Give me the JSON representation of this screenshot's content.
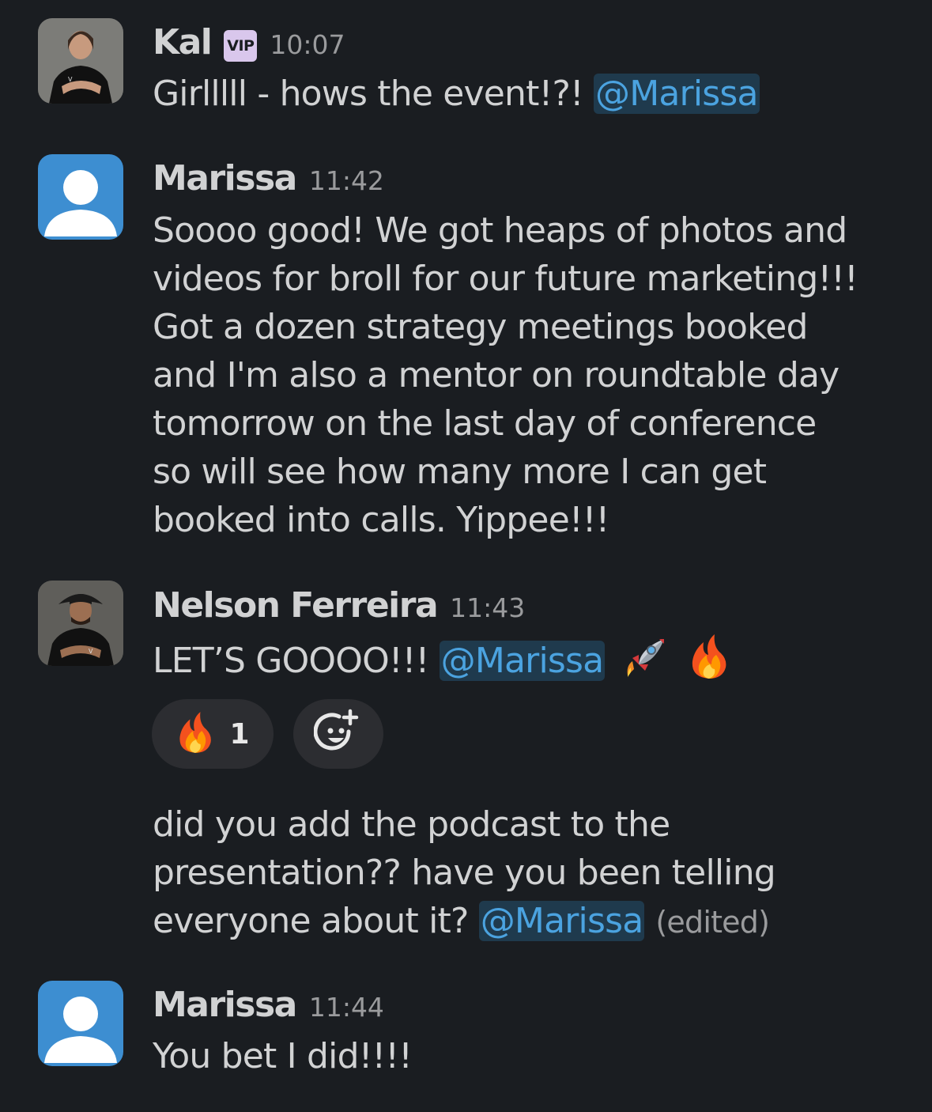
{
  "messages": [
    {
      "author": "Kal",
      "badge": "VIP",
      "time": "10:07",
      "avatar": "kal-avatar",
      "text": "Girlllll - hows the event!?! ",
      "mention": "@Marissa"
    },
    {
      "author": "Marissa",
      "time": "11:42",
      "avatar": "default-user-avatar",
      "lines": [
        "Soooo good! We got heaps of photos and",
        "videos for broll for our future marketing!!!",
        "Got a dozen strategy meetings booked",
        "and I'm also a mentor on roundtable day",
        "tomorrow on the last day of conference",
        "so will see how many more I can get",
        "booked into calls. Yippee!!!"
      ]
    },
    {
      "author": "Nelson Ferreira",
      "time": "11:43",
      "avatar": "nelson-avatar",
      "text": "LET’S GOOOO!!! ",
      "mention": "@Marissa",
      "emojis": [
        "rocket",
        "fire"
      ],
      "reactions": [
        {
          "emoji": "fire",
          "count": "1"
        }
      ],
      "add_reaction_icon": "add-reaction-icon"
    },
    {
      "lines": [
        "did you add the podcast to the",
        "presentation?? have you been telling",
        "everyone about it? "
      ],
      "mention": "@Marissa",
      "edited": "(edited)"
    },
    {
      "author": "Marissa",
      "time": "11:44",
      "avatar": "default-user-avatar",
      "text": "You bet I did!!!!"
    }
  ],
  "colors": {
    "background": "#1a1d21",
    "text": "#d1d2d3",
    "timestamp": "#9a9b9d",
    "mention_text": "#4ba3e0",
    "mention_bg": "#1f3a4d",
    "vip_badge": "#d9c7ec",
    "reaction_pill": "#2c2d31",
    "default_avatar": "#3d8ed1"
  }
}
